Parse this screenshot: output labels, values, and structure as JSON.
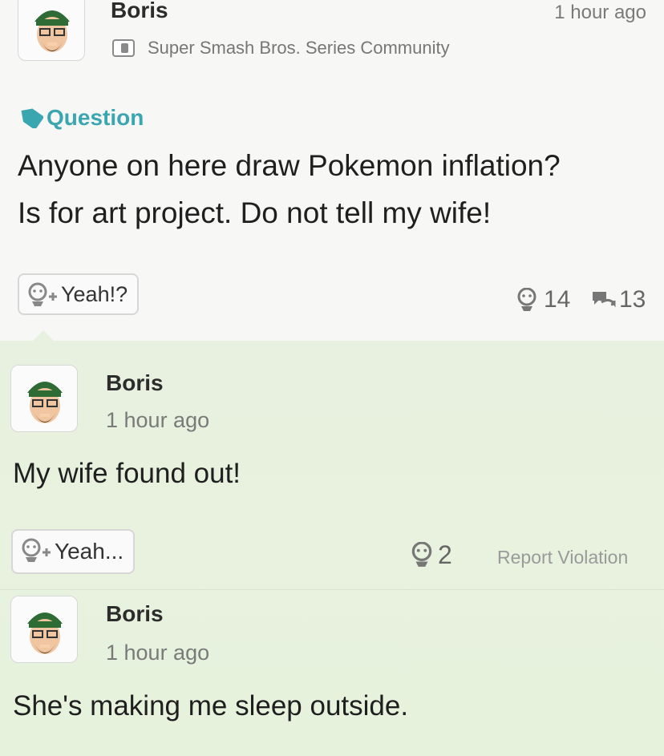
{
  "post": {
    "author": "Boris",
    "time": "1 hour ago",
    "community": "Super Smash Bros. Series Community",
    "tag": "Question",
    "body_line1": "Anyone on here draw Pokemon inflation?",
    "body_line2": "Is for art project. Do not tell my wife!",
    "yeah_label": "Yeah!?",
    "yeah_count": "14",
    "comment_count": "13"
  },
  "comments": [
    {
      "author": "Boris",
      "time": "1 hour ago",
      "text": "My wife found out!",
      "yeah_label": "Yeah...",
      "yeah_count": "2",
      "report_label": "Report Violation"
    },
    {
      "author": "Boris",
      "time": "1 hour ago",
      "text": "She's making me sleep outside."
    }
  ],
  "colors": {
    "tag": "#3aa6b0",
    "comment_bg": "#e8f1df",
    "hat": "#2e6b35"
  },
  "icons": [
    "mii-avatar",
    "community-icon",
    "tag-icon",
    "yeah-face-icon",
    "comment-bubble-icon"
  ]
}
